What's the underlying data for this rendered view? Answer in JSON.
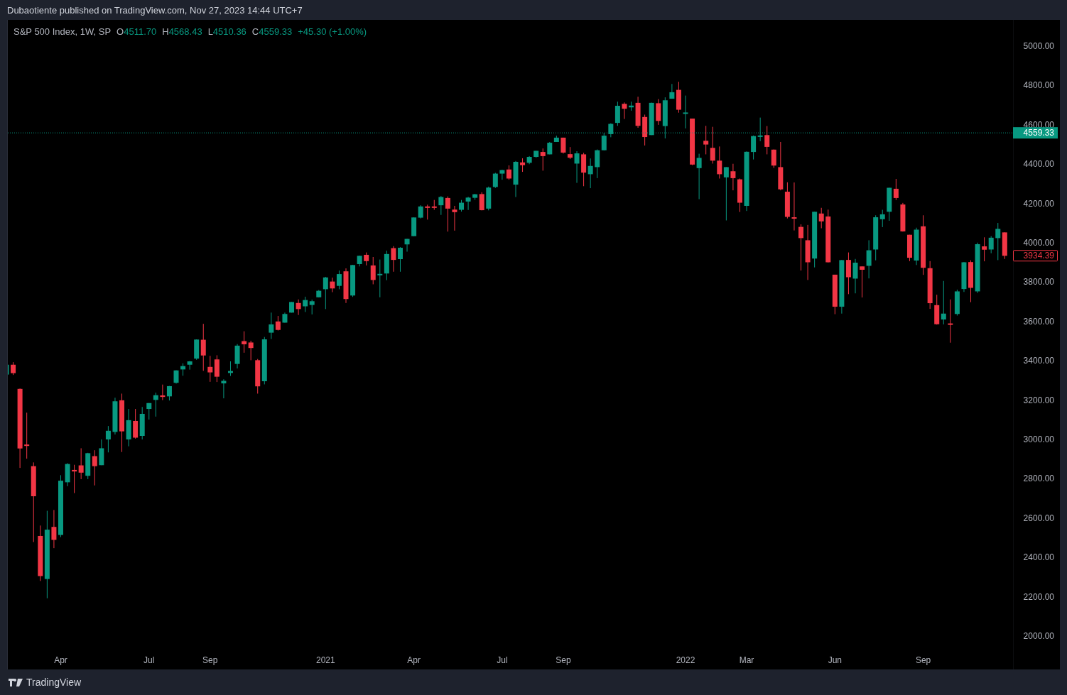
{
  "header": {
    "text": "Dubaotiente published on TradingView.com, Nov 27, 2023 14:44 UTC+7"
  },
  "legend": {
    "symbol": "S&P 500 Index, 1W, SP",
    "fields": [
      {
        "label": "O",
        "value": "4511.70"
      },
      {
        "label": "H",
        "value": "4568.43"
      },
      {
        "label": "L",
        "value": "4510.36"
      },
      {
        "label": "C",
        "value": "4559.33"
      }
    ],
    "change": "+45.30 (+1.00%)"
  },
  "chart": {
    "price_labels": [
      {
        "kind": "close",
        "text": "3934.39"
      }
    ],
    "chart_data": {
      "type": "candlestick",
      "ylim": [
        1830,
        5134
      ],
      "ref_lines": [
        {
          "axis": "y",
          "value": 4559.33,
          "label": "4559.33",
          "color": "#089981"
        }
      ],
      "yticks": [
        {
          "value": 2000,
          "label": "2000.00"
        },
        {
          "value": 2200,
          "label": "2200.00"
        },
        {
          "value": 2400,
          "label": "2400.00"
        },
        {
          "value": 2600,
          "label": "2600.00"
        },
        {
          "value": 2800,
          "label": "2800.00"
        },
        {
          "value": 3000,
          "label": "3000.00"
        },
        {
          "value": 3200,
          "label": "3200.00"
        },
        {
          "value": 3400,
          "label": "3400.00"
        },
        {
          "value": 3600,
          "label": "3600.00"
        },
        {
          "value": 3800,
          "label": "3800.00"
        },
        {
          "value": 4000,
          "label": "4000.00"
        },
        {
          "value": 4200,
          "label": "4200.00"
        },
        {
          "value": 4400,
          "label": "4400.00"
        },
        {
          "value": 4600,
          "label": "4600.00"
        },
        {
          "value": 4800,
          "label": "4800.00"
        },
        {
          "value": 5000,
          "label": "5000.00"
        }
      ],
      "categories": [
        null,
        null,
        null,
        null,
        null,
        null,
        null,
        null,
        "Apr",
        null,
        null,
        null,
        null,
        null,
        null,
        null,
        null,
        null,
        null,
        null,
        null,
        "Jul",
        null,
        null,
        null,
        null,
        null,
        null,
        null,
        null,
        "Sep",
        null,
        null,
        null,
        null,
        null,
        null,
        null,
        null,
        null,
        null,
        null,
        null,
        null,
        null,
        null,
        null,
        "2021",
        null,
        null,
        null,
        null,
        null,
        null,
        null,
        null,
        null,
        null,
        null,
        null,
        "Apr",
        null,
        null,
        null,
        null,
        null,
        null,
        null,
        null,
        null,
        null,
        null,
        null,
        "Jul",
        null,
        null,
        null,
        null,
        null,
        null,
        null,
        null,
        "Sep",
        null,
        null,
        null,
        null,
        null,
        null,
        null,
        null,
        null,
        null,
        null,
        null,
        null,
        null,
        null,
        null,
        null,
        "2022",
        null,
        null,
        null,
        null,
        null,
        null,
        null,
        null,
        "Mar",
        null,
        null,
        null,
        null,
        null,
        null,
        null,
        null,
        null,
        null,
        null,
        null,
        "Jun",
        null,
        null,
        null,
        null,
        null,
        null,
        null,
        null,
        null,
        null,
        null,
        null,
        "Sep",
        null,
        null,
        null,
        null,
        null,
        null,
        null,
        null,
        null,
        null,
        null,
        null
      ],
      "ohlc": [
        [
          3330,
          3385,
          3330,
          3380
        ],
        [
          3380,
          3393,
          3328,
          3337
        ],
        [
          3257,
          3259,
          2855,
          2954
        ],
        [
          2974,
          3136,
          2902,
          2972
        ],
        [
          2864,
          2883,
          2478,
          2711
        ],
        [
          2509,
          2562,
          2280,
          2305
        ],
        [
          2290,
          2637,
          2192,
          2541
        ],
        [
          2555,
          2641,
          2447,
          2489
        ],
        [
          2514,
          2818,
          2503,
          2790
        ],
        [
          2782,
          2879,
          2762,
          2875
        ],
        [
          2845,
          2871,
          2727,
          2837
        ],
        [
          2868,
          2955,
          2798,
          2831
        ],
        [
          2815,
          2932,
          2798,
          2930
        ],
        [
          2915,
          2945,
          2766,
          2864
        ],
        [
          2869,
          3000,
          2869,
          2955
        ],
        [
          3000,
          3068,
          2934,
          3044
        ],
        [
          3038,
          3212,
          3025,
          3194
        ],
        [
          3199,
          3233,
          2936,
          3041
        ],
        [
          3000,
          3155,
          2965,
          3098
        ],
        [
          3094,
          3155,
          3004,
          3009
        ],
        [
          3018,
          3165,
          3000,
          3130
        ],
        [
          3155,
          3185,
          3101,
          3185
        ],
        [
          3201,
          3238,
          3116,
          3225
        ],
        [
          3224,
          3279,
          3200,
          3216
        ],
        [
          3219,
          3272,
          3198,
          3271
        ],
        [
          3288,
          3352,
          3284,
          3351
        ],
        [
          3356,
          3387,
          3324,
          3373
        ],
        [
          3380,
          3399,
          3355,
          3397
        ],
        [
          3411,
          3509,
          3405,
          3508
        ],
        [
          3507,
          3588,
          3349,
          3427
        ],
        [
          3369,
          3425,
          3293,
          3341
        ],
        [
          3407,
          3428,
          3292,
          3319
        ],
        [
          3285,
          3306,
          3209,
          3298
        ],
        [
          3338,
          3397,
          3323,
          3348
        ],
        [
          3384,
          3485,
          3361,
          3477
        ],
        [
          3500,
          3550,
          3441,
          3484
        ],
        [
          3493,
          3502,
          3403,
          3465
        ],
        [
          3403,
          3409,
          3233,
          3270
        ],
        [
          3296,
          3521,
          3280,
          3509
        ],
        [
          3543,
          3645,
          3511,
          3585
        ],
        [
          3600,
          3628,
          3554,
          3557
        ],
        [
          3594,
          3645,
          3594,
          3638
        ],
        [
          3645,
          3699,
          3645,
          3699
        ],
        [
          3694,
          3712,
          3633,
          3663
        ],
        [
          3677,
          3726,
          3648,
          3709
        ],
        [
          3684,
          3711,
          3636,
          3703
        ],
        [
          3723,
          3760,
          3723,
          3756
        ],
        [
          3764,
          3827,
          3663,
          3824
        ],
        [
          3803,
          3823,
          3749,
          3768
        ],
        [
          3781,
          3859,
          3764,
          3841
        ],
        [
          3855,
          3870,
          3694,
          3714
        ],
        [
          3732,
          3888,
          3725,
          3887
        ],
        [
          3892,
          3935,
          3880,
          3934
        ],
        [
          3939,
          3951,
          3885,
          3907
        ],
        [
          3885,
          3928,
          3789,
          3811
        ],
        [
          3842,
          3915,
          3723,
          3842
        ],
        [
          3844,
          3960,
          3810,
          3943
        ],
        [
          3973,
          3983,
          3853,
          3913
        ],
        [
          3917,
          3978,
          3853,
          3975
        ],
        [
          3992,
          4020,
          3955,
          4020
        ],
        [
          4034,
          4129,
          4034,
          4129
        ],
        [
          4128,
          4191,
          4124,
          4185
        ],
        [
          4185,
          4194,
          4118,
          4180
        ],
        [
          4185,
          4218,
          4168,
          4181
        ],
        [
          4191,
          4238,
          4142,
          4233
        ],
        [
          4228,
          4236,
          4057,
          4174
        ],
        [
          4169,
          4188,
          4062,
          4156
        ],
        [
          4168,
          4218,
          4159,
          4204
        ],
        [
          4210,
          4234,
          4167,
          4230
        ],
        [
          4229,
          4249,
          4219,
          4247
        ],
        [
          4248,
          4257,
          4165,
          4166
        ],
        [
          4174,
          4286,
          4165,
          4281
        ],
        [
          4284,
          4356,
          4279,
          4352
        ],
        [
          4352,
          4372,
          4321,
          4370
        ],
        [
          4373,
          4394,
          4321,
          4327
        ],
        [
          4296,
          4416,
          4233,
          4412
        ],
        [
          4409,
          4430,
          4361,
          4395
        ],
        [
          4407,
          4441,
          4400,
          4437
        ],
        [
          4437,
          4468,
          4433,
          4468
        ],
        [
          4462,
          4480,
          4367,
          4441
        ],
        [
          4450,
          4513,
          4450,
          4509
        ],
        [
          4513,
          4545,
          4513,
          4535
        ],
        [
          4535,
          4535,
          4454,
          4459
        ],
        [
          4451,
          4487,
          4426,
          4433
        ],
        [
          4403,
          4466,
          4305,
          4455
        ],
        [
          4450,
          4458,
          4288,
          4357
        ],
        [
          4349,
          4429,
          4278,
          4391
        ],
        [
          4385,
          4475,
          4329,
          4471
        ],
        [
          4471,
          4559,
          4470,
          4545
        ],
        [
          4553,
          4608,
          4537,
          4605
        ],
        [
          4610,
          4718,
          4595,
          4697
        ],
        [
          4707,
          4714,
          4630,
          4682
        ],
        [
          4689,
          4718,
          4672,
          4698
        ],
        [
          4712,
          4743,
          4585,
          4595
        ],
        [
          4640,
          4652,
          4495,
          4538
        ],
        [
          4548,
          4713,
          4548,
          4712
        ],
        [
          4710,
          4731,
          4600,
          4620
        ],
        [
          4594,
          4740,
          4531,
          4725
        ],
        [
          4733,
          4808,
          4733,
          4766
        ],
        [
          4778,
          4819,
          4662,
          4677
        ],
        [
          4662,
          4749,
          4582,
          4663
        ],
        [
          4632,
          4632,
          4395,
          4398
        ],
        [
          4380,
          4453,
          4222,
          4432
        ],
        [
          4519,
          4595,
          4450,
          4500
        ],
        [
          4483,
          4590,
          4403,
          4418
        ],
        [
          4418,
          4490,
          4327,
          4349
        ],
        [
          4333,
          4385,
          4114,
          4385
        ],
        [
          4364,
          4402,
          4267,
          4329
        ],
        [
          4323,
          4327,
          4157,
          4204
        ],
        [
          4188,
          4465,
          4162,
          4463
        ],
        [
          4462,
          4546,
          4424,
          4543
        ],
        [
          4541,
          4637,
          4517,
          4546
        ],
        [
          4548,
          4594,
          4450,
          4488
        ],
        [
          4474,
          4475,
          4381,
          4393
        ],
        [
          4385,
          4513,
          4267,
          4272
        ],
        [
          4260,
          4308,
          4124,
          4132
        ],
        [
          4130,
          4307,
          4063,
          4123
        ],
        [
          4081,
          4094,
          3859,
          4024
        ],
        [
          4013,
          4091,
          3811,
          3901
        ],
        [
          3920,
          4158,
          3875,
          4158
        ],
        [
          4149,
          4178,
          4074,
          4109
        ],
        [
          4134,
          4169,
          3900,
          3901
        ],
        [
          3838,
          3838,
          3637,
          3675
        ],
        [
          3675,
          3913,
          3640,
          3912
        ],
        [
          3913,
          3951,
          3739,
          3825
        ],
        [
          3818,
          3918,
          3743,
          3899
        ],
        [
          3880,
          3880,
          3722,
          3863
        ],
        [
          3883,
          4013,
          3819,
          3962
        ],
        [
          3966,
          4140,
          3911,
          4130
        ],
        [
          4120,
          4168,
          4080,
          4145
        ],
        [
          4158,
          4280,
          4112,
          4280
        ],
        [
          4275,
          4325,
          4218,
          4228
        ],
        [
          4195,
          4203,
          4057,
          4058
        ],
        [
          4041,
          4041,
          3907,
          3924
        ],
        [
          3910,
          4077,
          3887,
          4067
        ],
        [
          4084,
          4140,
          3837,
          3873
        ],
        [
          3871,
          3907,
          3664,
          3693
        ],
        [
          3683,
          3736,
          3584,
          3586
        ],
        [
          3610,
          3806,
          3585,
          3640
        ],
        [
          3590,
          3712,
          3492,
          3583
        ],
        [
          3638,
          3762,
          3630,
          3753
        ],
        [
          3765,
          3902,
          3750,
          3901
        ],
        [
          3902,
          3911,
          3698,
          3771
        ],
        [
          3753,
          4001,
          3745,
          3993
        ],
        [
          3982,
          4028,
          3906,
          3965
        ],
        [
          3966,
          4034,
          3947,
          4026
        ],
        [
          4024,
          4101,
          3912,
          4071
        ],
        [
          4053,
          4053,
          3918,
          3934
        ]
      ]
    }
  },
  "footer": {
    "brand": "TradingView"
  }
}
